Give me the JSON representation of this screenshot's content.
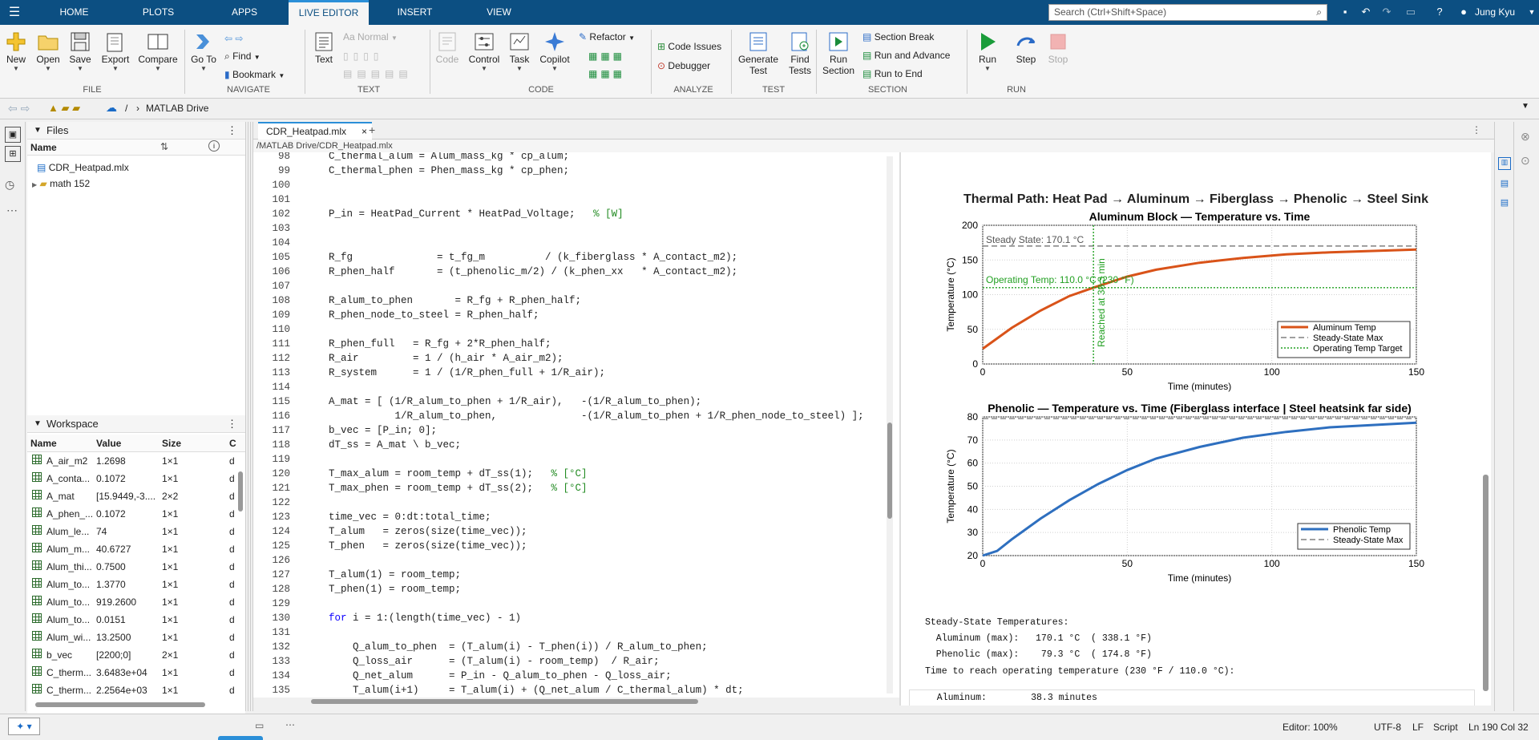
{
  "topbar": {
    "tabs": [
      "HOME",
      "PLOTS",
      "APPS",
      "LIVE EDITOR",
      "INSERT",
      "VIEW"
    ],
    "search_placeholder": "Search (Ctrl+Shift+Space)",
    "user": "Jung Kyu"
  },
  "ribbon": {
    "file": {
      "new": "New",
      "open": "Open",
      "save": "Save",
      "export": "Export",
      "compare": "Compare",
      "group": "FILE"
    },
    "navigate": {
      "goto": "Go To",
      "find": "Find",
      "bookmark": "Bookmark",
      "group": "NAVIGATE"
    },
    "text": {
      "text": "Text",
      "normal": "Normal",
      "group": "TEXT"
    },
    "code": {
      "code": "Code",
      "control": "Control",
      "task": "Task",
      "copilot": "Copilot",
      "refactor": "Refactor",
      "group": "CODE"
    },
    "analyze": {
      "code_issues": "Code Issues",
      "debugger": "Debugger",
      "group": "ANALYZE"
    },
    "test": {
      "generate_test": "Generate Test",
      "find_tests": "Find Tests",
      "group": "TEST"
    },
    "section": {
      "run_section": "Run Section",
      "section_break": "Section Break",
      "run_and_advance": "Run and Advance",
      "run_to_end": "Run to End",
      "group": "SECTION"
    },
    "run": {
      "run": "Run",
      "step": "Step",
      "stop": "Stop",
      "group": "RUN"
    }
  },
  "address": {
    "root": "/",
    "folder": "MATLAB Drive"
  },
  "files_panel": {
    "title": "Files",
    "col_name": "Name",
    "items": [
      {
        "name": "CDR_Heatpad.mlx"
      },
      {
        "name": "math 152"
      }
    ]
  },
  "workspace": {
    "title": "Workspace",
    "columns": [
      "Name",
      "Value",
      "Size",
      "C"
    ],
    "rows": [
      {
        "name": "A_air_m2",
        "value": "1.2698",
        "size": "1×1",
        "c": "d"
      },
      {
        "name": "A_conta...",
        "value": "0.1072",
        "size": "1×1",
        "c": "d"
      },
      {
        "name": "A_mat",
        "value": "[15.9449,-3....",
        "size": "2×2",
        "c": "d"
      },
      {
        "name": "A_phen_...",
        "value": "0.1072",
        "size": "1×1",
        "c": "d"
      },
      {
        "name": "Alum_le...",
        "value": "74",
        "size": "1×1",
        "c": "d"
      },
      {
        "name": "Alum_m...",
        "value": "40.6727",
        "size": "1×1",
        "c": "d"
      },
      {
        "name": "Alum_thi...",
        "value": "0.7500",
        "size": "1×1",
        "c": "d"
      },
      {
        "name": "Alum_to...",
        "value": "1.3770",
        "size": "1×1",
        "c": "d"
      },
      {
        "name": "Alum_to...",
        "value": "919.2600",
        "size": "1×1",
        "c": "d"
      },
      {
        "name": "Alum_to...",
        "value": "0.0151",
        "size": "1×1",
        "c": "d"
      },
      {
        "name": "Alum_wi...",
        "value": "13.2500",
        "size": "1×1",
        "c": "d"
      },
      {
        "name": "b_vec",
        "value": "[2200;0]",
        "size": "2×1",
        "c": "d"
      },
      {
        "name": "C_therm...",
        "value": "3.6483e+04",
        "size": "1×1",
        "c": "d"
      },
      {
        "name": "C_therm...",
        "value": "2.2564e+03",
        "size": "1×1",
        "c": "d"
      }
    ]
  },
  "editor": {
    "tab": "CDR_Heatpad.mlx",
    "path": "/MATLAB Drive/CDR_Heatpad.mlx",
    "lines": [
      {
        "n": "98",
        "t": "C_thermal_alum = Alum_mass_kg * cp_alum;"
      },
      {
        "n": "99",
        "t": "C_thermal_phen = Phen_mass_kg * cp_phen;"
      },
      {
        "n": "100",
        "t": ""
      },
      {
        "n": "101",
        "t": ""
      },
      {
        "n": "102",
        "t": "P_in = HeatPad_Current * HeatPad_Voltage;   ",
        "c": "% [W]"
      },
      {
        "n": "103",
        "t": ""
      },
      {
        "n": "104",
        "t": ""
      },
      {
        "n": "105",
        "t": "R_fg              = t_fg_m          / (k_fiberglass * A_contact_m2);"
      },
      {
        "n": "106",
        "t": "R_phen_half       = (t_phenolic_m/2) / (k_phen_xx   * A_contact_m2);"
      },
      {
        "n": "107",
        "t": ""
      },
      {
        "n": "108",
        "t": "R_alum_to_phen       = R_fg + R_phen_half;"
      },
      {
        "n": "109",
        "t": "R_phen_node_to_steel = R_phen_half;"
      },
      {
        "n": "110",
        "t": ""
      },
      {
        "n": "111",
        "t": "R_phen_full   = R_fg + 2*R_phen_half;"
      },
      {
        "n": "112",
        "t": "R_air         = 1 / (h_air * A_air_m2);"
      },
      {
        "n": "113",
        "t": "R_system      = 1 / (1/R_phen_full + 1/R_air);"
      },
      {
        "n": "114",
        "t": ""
      },
      {
        "n": "115",
        "t": "A_mat = [ (1/R_alum_to_phen + 1/R_air),   -(1/R_alum_to_phen);"
      },
      {
        "n": "116",
        "t": "           1/R_alum_to_phen,              -(1/R_alum_to_phen + 1/R_phen_node_to_steel) ];"
      },
      {
        "n": "117",
        "t": "b_vec = [P_in; 0];"
      },
      {
        "n": "118",
        "t": "dT_ss = A_mat \\ b_vec;"
      },
      {
        "n": "119",
        "t": ""
      },
      {
        "n": "120",
        "t": "T_max_alum = room_temp + dT_ss(1);   ",
        "c": "% [°C]"
      },
      {
        "n": "121",
        "t": "T_max_phen = room_temp + dT_ss(2);   ",
        "c": "% [°C]"
      },
      {
        "n": "122",
        "t": ""
      },
      {
        "n": "123",
        "t": "time_vec = 0:dt:total_time;"
      },
      {
        "n": "124",
        "t": "T_alum   = zeros(size(time_vec));"
      },
      {
        "n": "125",
        "t": "T_phen   = zeros(size(time_vec));"
      },
      {
        "n": "126",
        "t": ""
      },
      {
        "n": "127",
        "t": "T_alum(1) = room_temp;"
      },
      {
        "n": "128",
        "t": "T_phen(1) = room_temp;"
      },
      {
        "n": "129",
        "t": ""
      },
      {
        "n": "130",
        "k": "for",
        "t": " i = 1:(length(time_vec) - 1)"
      },
      {
        "n": "131",
        "t": ""
      },
      {
        "n": "132",
        "t": "    Q_alum_to_phen  = (T_alum(i) - T_phen(i)) / R_alum_to_phen;"
      },
      {
        "n": "133",
        "t": "    Q_loss_air      = (T_alum(i) - room_temp)  / R_air;"
      },
      {
        "n": "134",
        "t": "    Q_net_alum      = P_in - Q_alum_to_phen - Q_loss_air;"
      },
      {
        "n": "135",
        "t": "    T_alum(i+1)     = T_alum(i) + (Q_net_alum / C_thermal_alum) * dt;"
      },
      {
        "n": "136",
        "t": ""
      }
    ]
  },
  "output": {
    "suptitle": "Thermal Path: Heat Pad → Aluminum → Fiberglass → Phenolic → Steel Sink",
    "text_lines": [
      "Steady-State Temperatures:",
      "  Aluminum (max):   170.1 °C  ( 338.1 °F)",
      "  Phenolic (max):    79.3 °C  ( 174.8 °F)",
      "Time to reach operating temperature (230 °F / 110.0 °C):"
    ],
    "aluminum_time": "  Aluminum:        38.3 minutes"
  },
  "chart_data": [
    {
      "type": "line",
      "title": "Aluminum Block — Temperature vs. Time",
      "xlabel": "Time (minutes)",
      "ylabel": "Temperature (°C)",
      "xlim": [
        0,
        150
      ],
      "ylim": [
        0,
        200
      ],
      "xticks": [
        0,
        50,
        100,
        150
      ],
      "yticks": [
        0,
        50,
        100,
        150,
        200
      ],
      "grid": true,
      "legend": "bottom-right",
      "series": [
        {
          "name": "Aluminum Temp",
          "color": "#d95319",
          "x": [
            0,
            10,
            20,
            30,
            38.3,
            50,
            60,
            75,
            90,
            105,
            120,
            135,
            150
          ],
          "y": [
            22,
            52,
            77,
            98,
            110,
            126,
            136,
            146,
            153,
            158,
            161,
            163,
            165
          ]
        },
        {
          "name": "Steady-State Max",
          "color": "#808080",
          "dash": "dashed",
          "value": 170.1
        },
        {
          "name": "Operating Temp Target",
          "color": "#22a022",
          "dash": "dotted",
          "value": 110
        }
      ],
      "annotations": [
        {
          "text": "Steady State: 170.1 °C",
          "color": "#555555"
        },
        {
          "text": "Operating Temp: 110.0 °C (230 °F)",
          "color": "#22a022"
        },
        {
          "text": "Reached at 38.3 min",
          "color": "#22a022",
          "x": 38.3
        }
      ]
    },
    {
      "type": "line",
      "title": "Phenolic — Temperature vs. Time  (Fiberglass interface | Steel heatsink far side)",
      "xlabel": "Time (minutes)",
      "ylabel": "Temperature (°C)",
      "xlim": [
        0,
        150
      ],
      "ylim": [
        20,
        80
      ],
      "xticks": [
        0,
        50,
        100,
        150
      ],
      "yticks": [
        20,
        30,
        40,
        50,
        60,
        70,
        80
      ],
      "grid": true,
      "legend": "bottom-right",
      "series": [
        {
          "name": "Phenolic Temp",
          "color": "#2e6fbf",
          "x": [
            0,
            5,
            10,
            20,
            30,
            40,
            50,
            60,
            75,
            90,
            105,
            120,
            135,
            150
          ],
          "y": [
            20,
            22,
            27,
            36,
            44,
            51,
            57,
            62,
            67,
            71,
            73.5,
            75.5,
            76.5,
            77.5
          ]
        },
        {
          "name": "Steady-State Max",
          "color": "#808080",
          "dash": "dashed",
          "value": 79.3
        }
      ]
    }
  ],
  "statusbar": {
    "zoom": "Editor: 100%",
    "encoding": "UTF-8",
    "eol": "LF",
    "mode": "Script",
    "position": "Ln  190  Col  32"
  }
}
